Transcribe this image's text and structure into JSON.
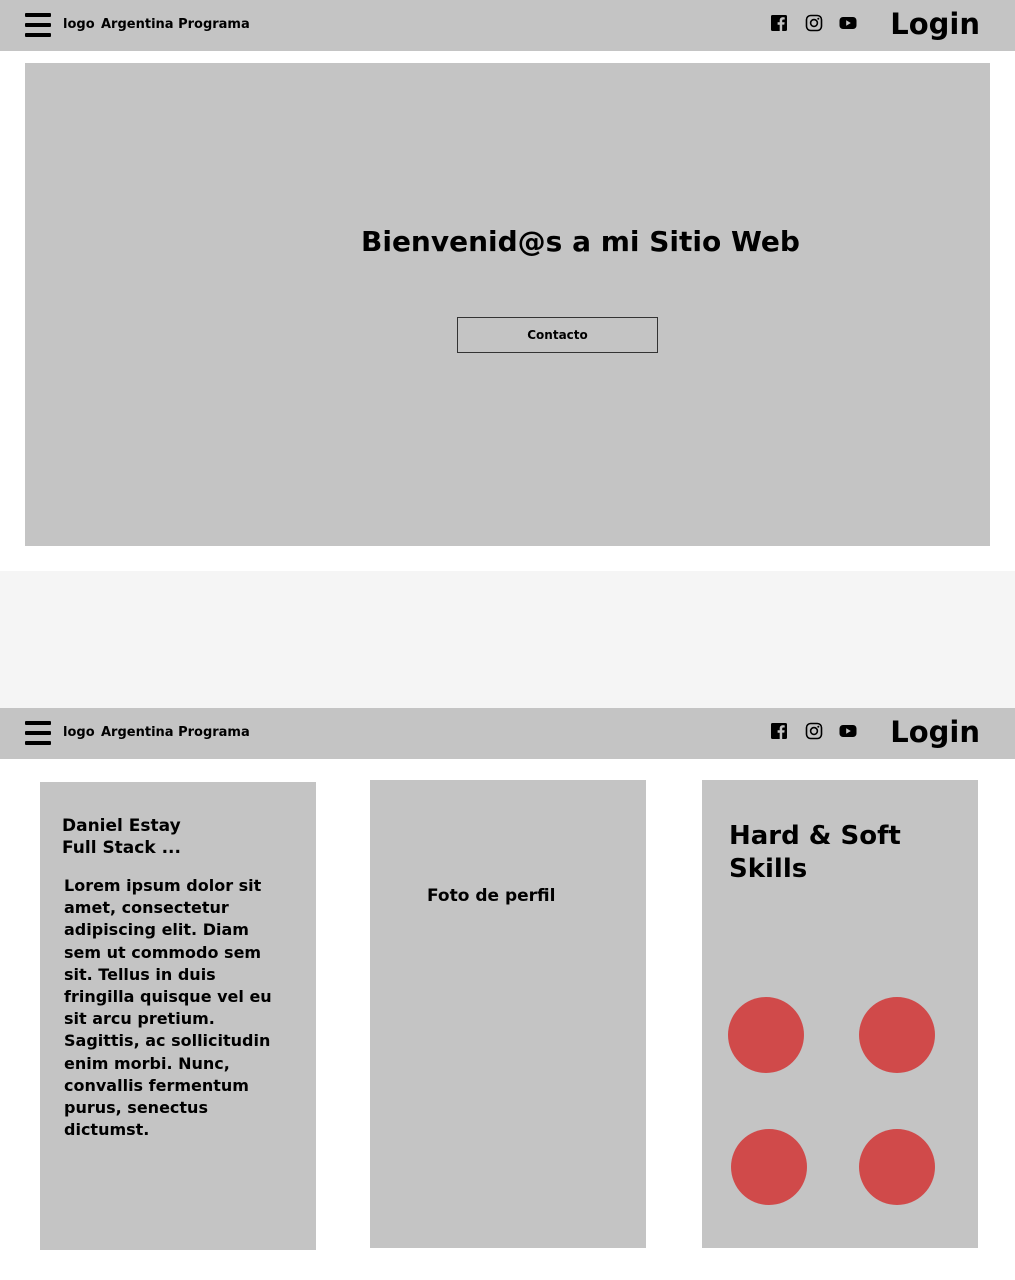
{
  "nav": {
    "logo": "logo",
    "brand": "Argentina Programa",
    "login": "Login",
    "icons": [
      "menu-icon",
      "facebook-icon",
      "instagram-icon",
      "youtube-icon"
    ]
  },
  "hero": {
    "title": "Bienvenid@s a mi Sitio Web",
    "contact_button": "Contacto"
  },
  "about": {
    "name": "Daniel Estay",
    "role": "Full Stack ...",
    "text": "Lorem ipsum dolor sit amet, consectetur adipiscing elit. Diam sem ut commodo sem sit. Tellus in duis fringilla quisque vel eu sit arcu pretium. Sagittis, ac sollicitudin enim morbi. Nunc, convallis fermentum purus, senectus dictumst."
  },
  "photo": {
    "label": "Foto de perfil"
  },
  "skills": {
    "title": "Hard & Soft Skills",
    "dot_color": "#d04a4a",
    "dots": 4
  },
  "colors": {
    "panel": "#c4c4c4",
    "band": "#f5f5f5",
    "accent": "#d04a4a"
  }
}
